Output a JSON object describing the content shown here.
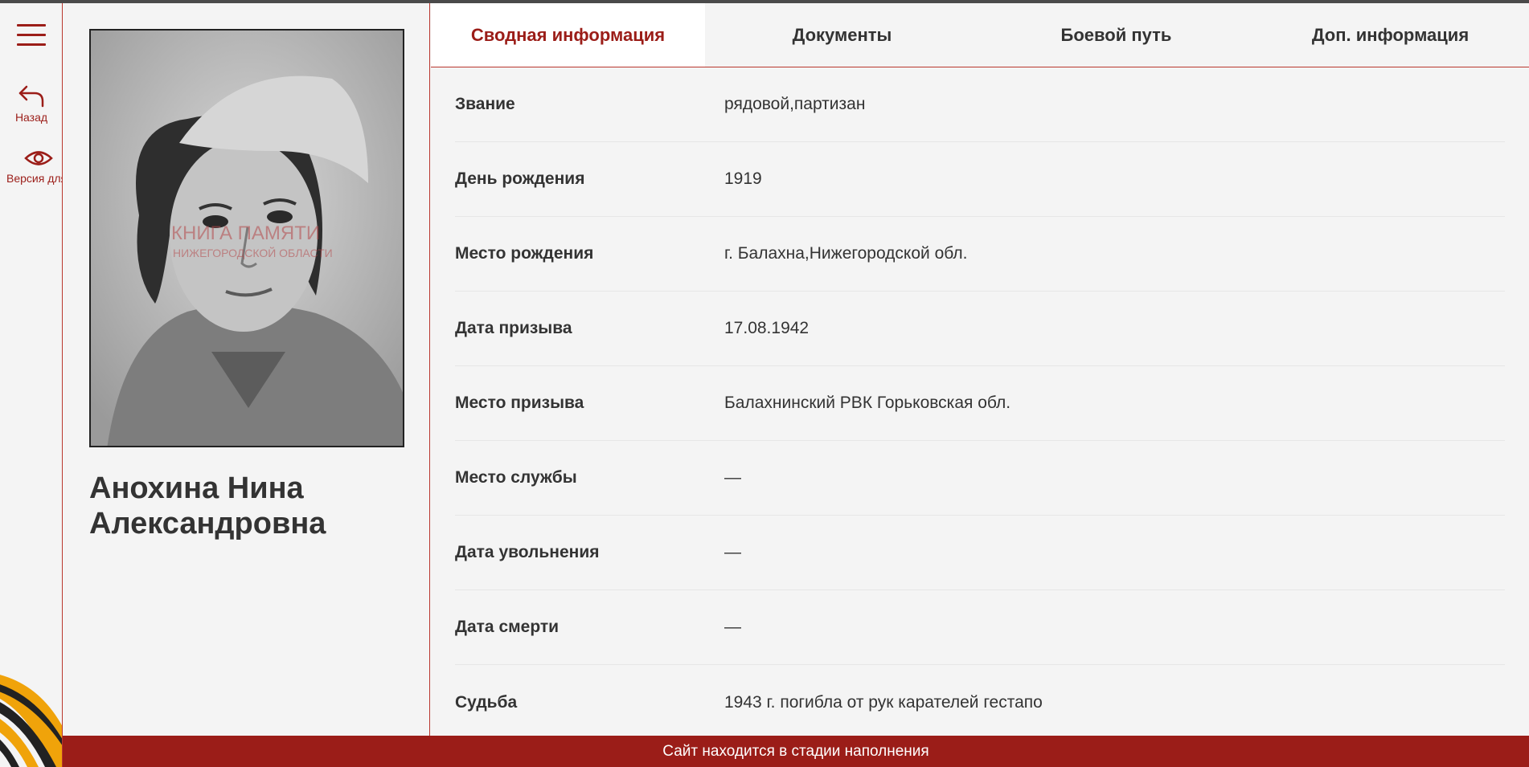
{
  "sidebar": {
    "back_label": "Назад",
    "version_label": "Версия для слабовидящих"
  },
  "person": {
    "name": "Анохина Нина Александровна",
    "photo_watermark_line1": "КНИГА ПАМЯТИ",
    "photo_watermark_line2": "НИЖЕГОРОДСКОЙ ОБЛАСТИ"
  },
  "tabs": [
    {
      "label": "Сводная информация",
      "active": true
    },
    {
      "label": "Документы",
      "active": false
    },
    {
      "label": "Боевой путь",
      "active": false
    },
    {
      "label": "Доп. информация",
      "active": false
    }
  ],
  "info_rows": [
    {
      "label": "Звание",
      "value": "рядовой,партизан"
    },
    {
      "label": "День рождения",
      "value": "1919"
    },
    {
      "label": "Место рождения",
      "value": "г. Балахна,Нижегородской обл."
    },
    {
      "label": "Дата призыва",
      "value": "17.08.1942"
    },
    {
      "label": "Место призыва",
      "value": "Балахнинский РВК Горьковская обл."
    },
    {
      "label": "Место службы",
      "value": "—"
    },
    {
      "label": "Дата увольнения",
      "value": "—"
    },
    {
      "label": "Дата смерти",
      "value": "—"
    },
    {
      "label": "Судьба",
      "value": "1943 г. погибла от рук карателей гестапо"
    }
  ],
  "banner": {
    "text": "Сайт находится в стадии наполнения"
  },
  "colors": {
    "accent": "#9b1d18",
    "background": "#f4f4f4",
    "ribbon_orange": "#f0a30a",
    "ribbon_black": "#222222"
  }
}
